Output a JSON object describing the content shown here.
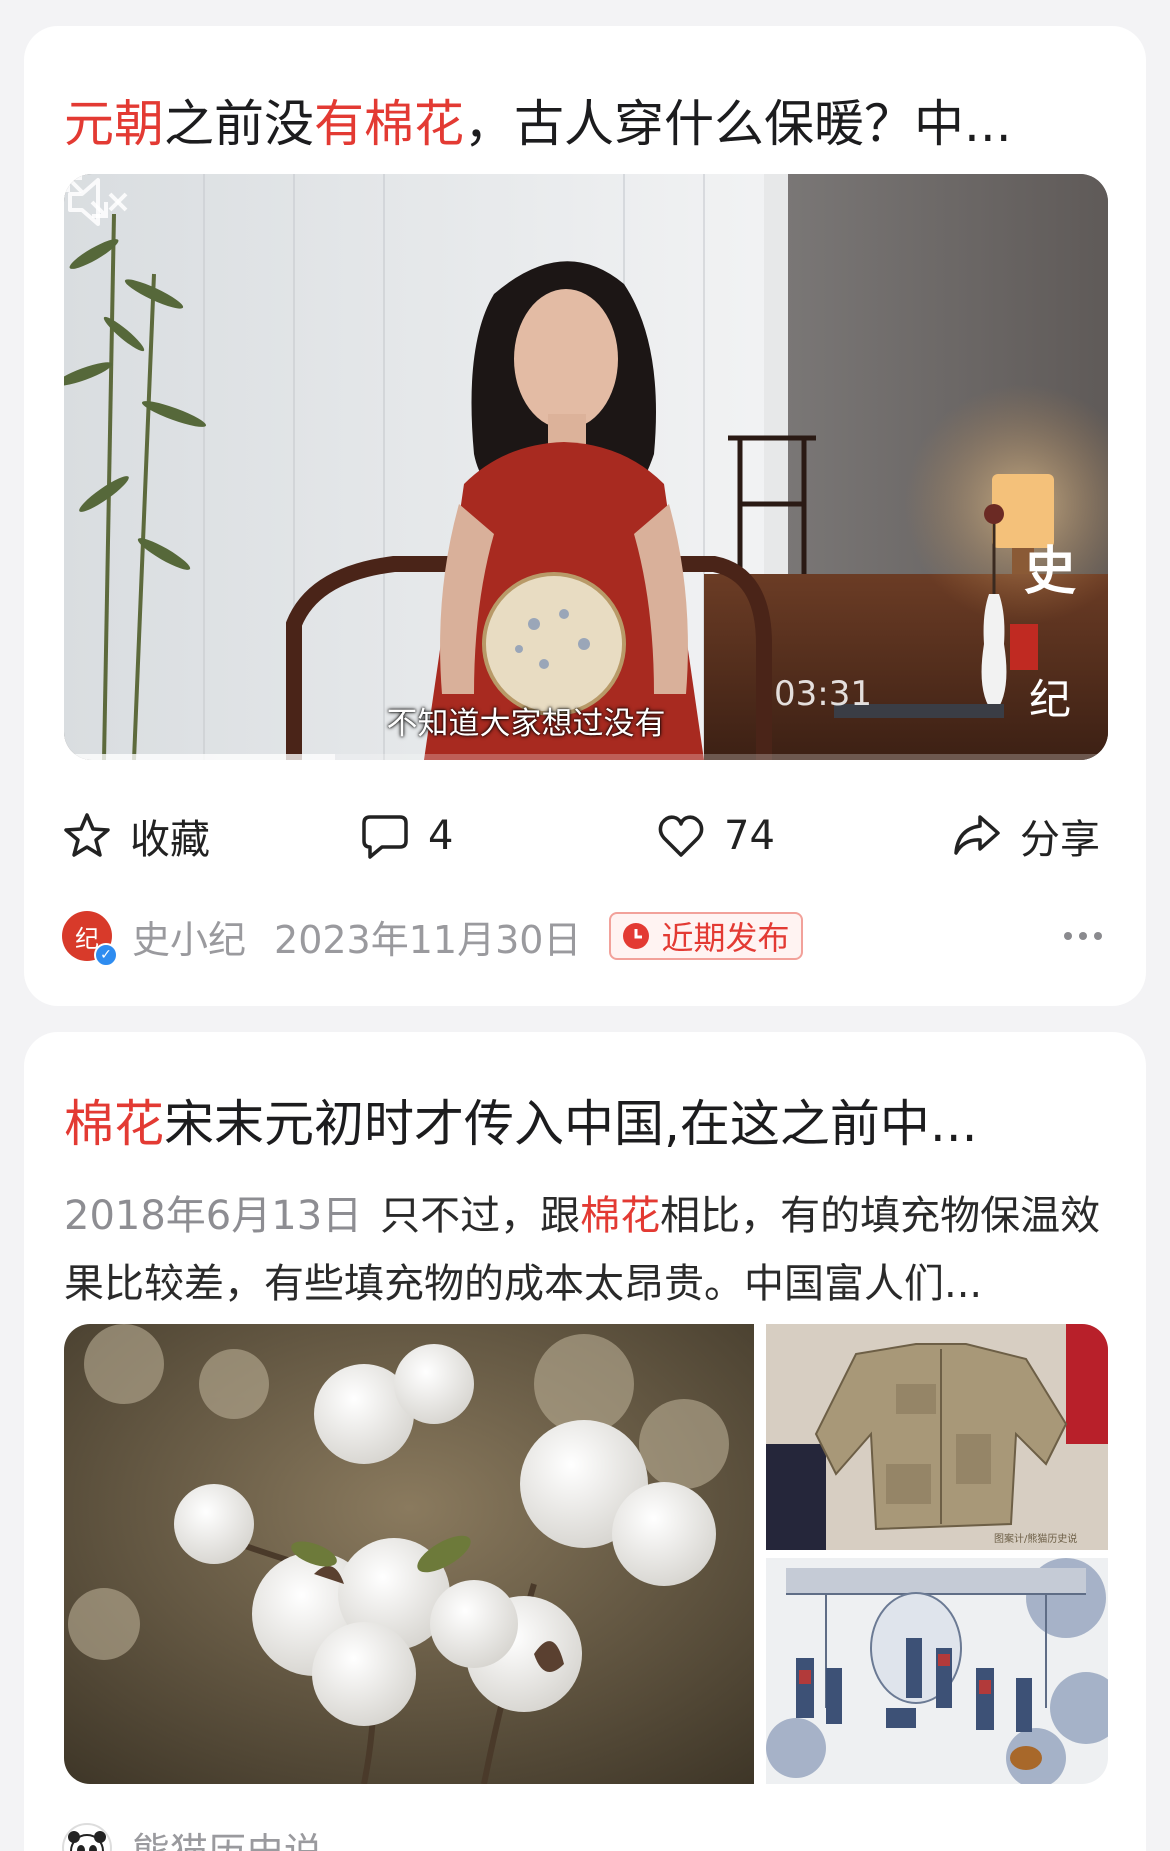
{
  "card1": {
    "title_parts": {
      "p1": "元朝",
      "p2": "之前没",
      "p3": "有棉花",
      "p4": "，古人穿什么保暖？中..."
    },
    "video": {
      "subtitle": "不知道大家想过没有",
      "duration": "03:31",
      "watermark": "史小纪",
      "progress": 0.26
    },
    "actions": {
      "favorite_label": "收藏",
      "comment_count": "4",
      "like_count": "74",
      "share_label": "分享"
    },
    "author": {
      "name": "史小纪",
      "date": "2023年11月30日",
      "badge": "近期发布"
    }
  },
  "card2": {
    "title_parts": {
      "p1": "棉花",
      "p2": "宋末元初时才传入中国,在这之前中..."
    },
    "snippet": {
      "date": "2018年6月13日",
      "text1": "只不过，跟",
      "highlight": "棉花",
      "text2": "相比，有的填充物保温效果比较差，有些填充物的成本太昂贵。中国富人们..."
    },
    "images": {
      "watermark": "图案计/熊猫历史说"
    },
    "author": {
      "name": "熊猫历史说"
    }
  },
  "colors": {
    "highlight": "#e33a33",
    "background": "#f3f3f5",
    "card": "#ffffff",
    "meta_gray": "#9a9a9e"
  },
  "icons": [
    "star-icon",
    "comment-icon",
    "heart-icon",
    "share-icon",
    "mute-icon",
    "fullscreen-icon",
    "clock-icon",
    "more-icon"
  ]
}
